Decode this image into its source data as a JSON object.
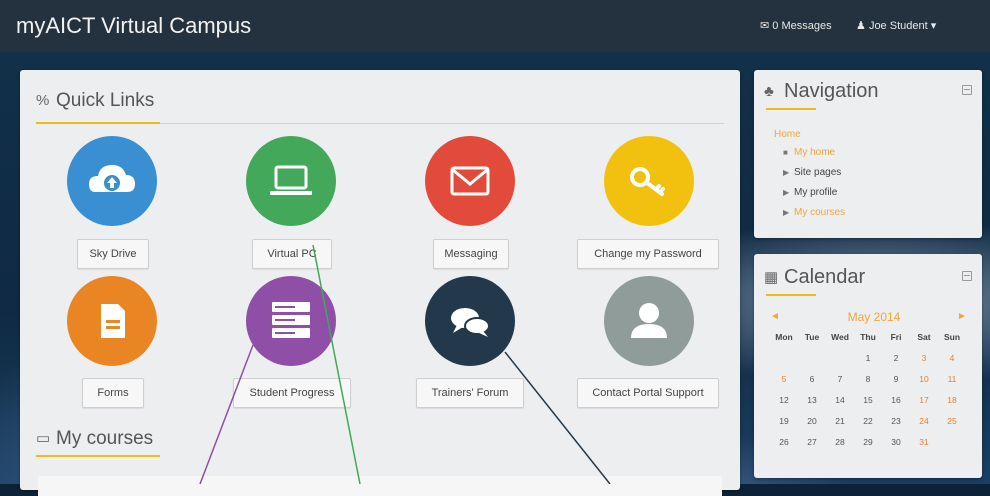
{
  "header": {
    "title": "myAICT Virtual Campus",
    "messages": "0 Messages",
    "user": "Joe Student"
  },
  "quick_links": {
    "heading": "Quick Links",
    "tiles": [
      {
        "label": "Sky Drive",
        "color": "#3a8fd2",
        "icon": "cloud-upload-icon"
      },
      {
        "label": "Virtual PC",
        "color": "#43a85a",
        "icon": "laptop-icon"
      },
      {
        "label": "Messaging",
        "color": "#e24b3c",
        "icon": "envelope-icon"
      },
      {
        "label": "Change my Password",
        "color": "#f2c10f",
        "icon": "key-icon"
      },
      {
        "label": "Forms",
        "color": "#e98523",
        "icon": "document-icon"
      },
      {
        "label": "Student Progress",
        "color": "#8f4fa7",
        "icon": "server-icon"
      },
      {
        "label": "Trainers' Forum",
        "color": "#23384b",
        "icon": "chat-bubbles-icon"
      },
      {
        "label": "Contact Portal Support",
        "color": "#8f9c9a",
        "icon": "user-icon"
      }
    ]
  },
  "my_courses": {
    "heading": "My courses"
  },
  "navigation": {
    "heading": "Navigation",
    "home": "Home",
    "items": [
      {
        "label": "My home",
        "highlight": true
      },
      {
        "label": "Site pages",
        "highlight": false
      },
      {
        "label": "My profile",
        "highlight": false
      },
      {
        "label": "My courses",
        "highlight": true
      }
    ]
  },
  "calendar": {
    "heading": "Calendar",
    "month": "May 2014",
    "prev": "◄",
    "next": "►",
    "weekdays": [
      "Mon",
      "Tue",
      "Wed",
      "Thu",
      "Fri",
      "Sat",
      "Sun"
    ],
    "weeks": [
      [
        "",
        "",
        "",
        "1",
        "2",
        "3",
        "4"
      ],
      [
        "5",
        "6",
        "7",
        "8",
        "9",
        "10",
        "11"
      ],
      [
        "12",
        "13",
        "14",
        "15",
        "16",
        "17",
        "18"
      ],
      [
        "19",
        "20",
        "21",
        "22",
        "23",
        "24",
        "25"
      ],
      [
        "26",
        "27",
        "28",
        "29",
        "30",
        "31",
        ""
      ]
    ]
  },
  "colors": {
    "accent": "#f0ba18",
    "topbar": "#23323e",
    "callout_purple": "#8f4fa7",
    "callout_green": "#43a85a",
    "callout_navy": "#23384b"
  }
}
